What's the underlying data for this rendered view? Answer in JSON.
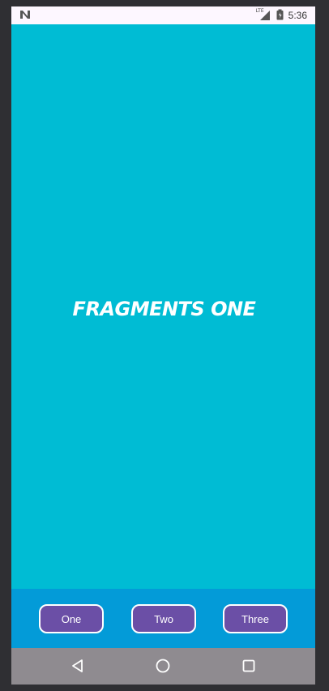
{
  "status_bar": {
    "time": "5:36",
    "lte_label": "LTE",
    "left_icon": "n-notification-icon",
    "signal_icon": "signal-icon",
    "battery_icon": "battery-icon"
  },
  "main": {
    "title": "FRAGMENTS ONE",
    "background_color": "#00bcd4"
  },
  "bottom_nav": {
    "buttons": [
      {
        "label": "One"
      },
      {
        "label": "Two"
      },
      {
        "label": "Three"
      }
    ],
    "background_color": "#039bd8",
    "button_color": "#6b4fa6"
  },
  "system_nav": {
    "back_icon": "back-triangle-icon",
    "home_icon": "home-circle-icon",
    "recents_icon": "recents-square-icon"
  }
}
